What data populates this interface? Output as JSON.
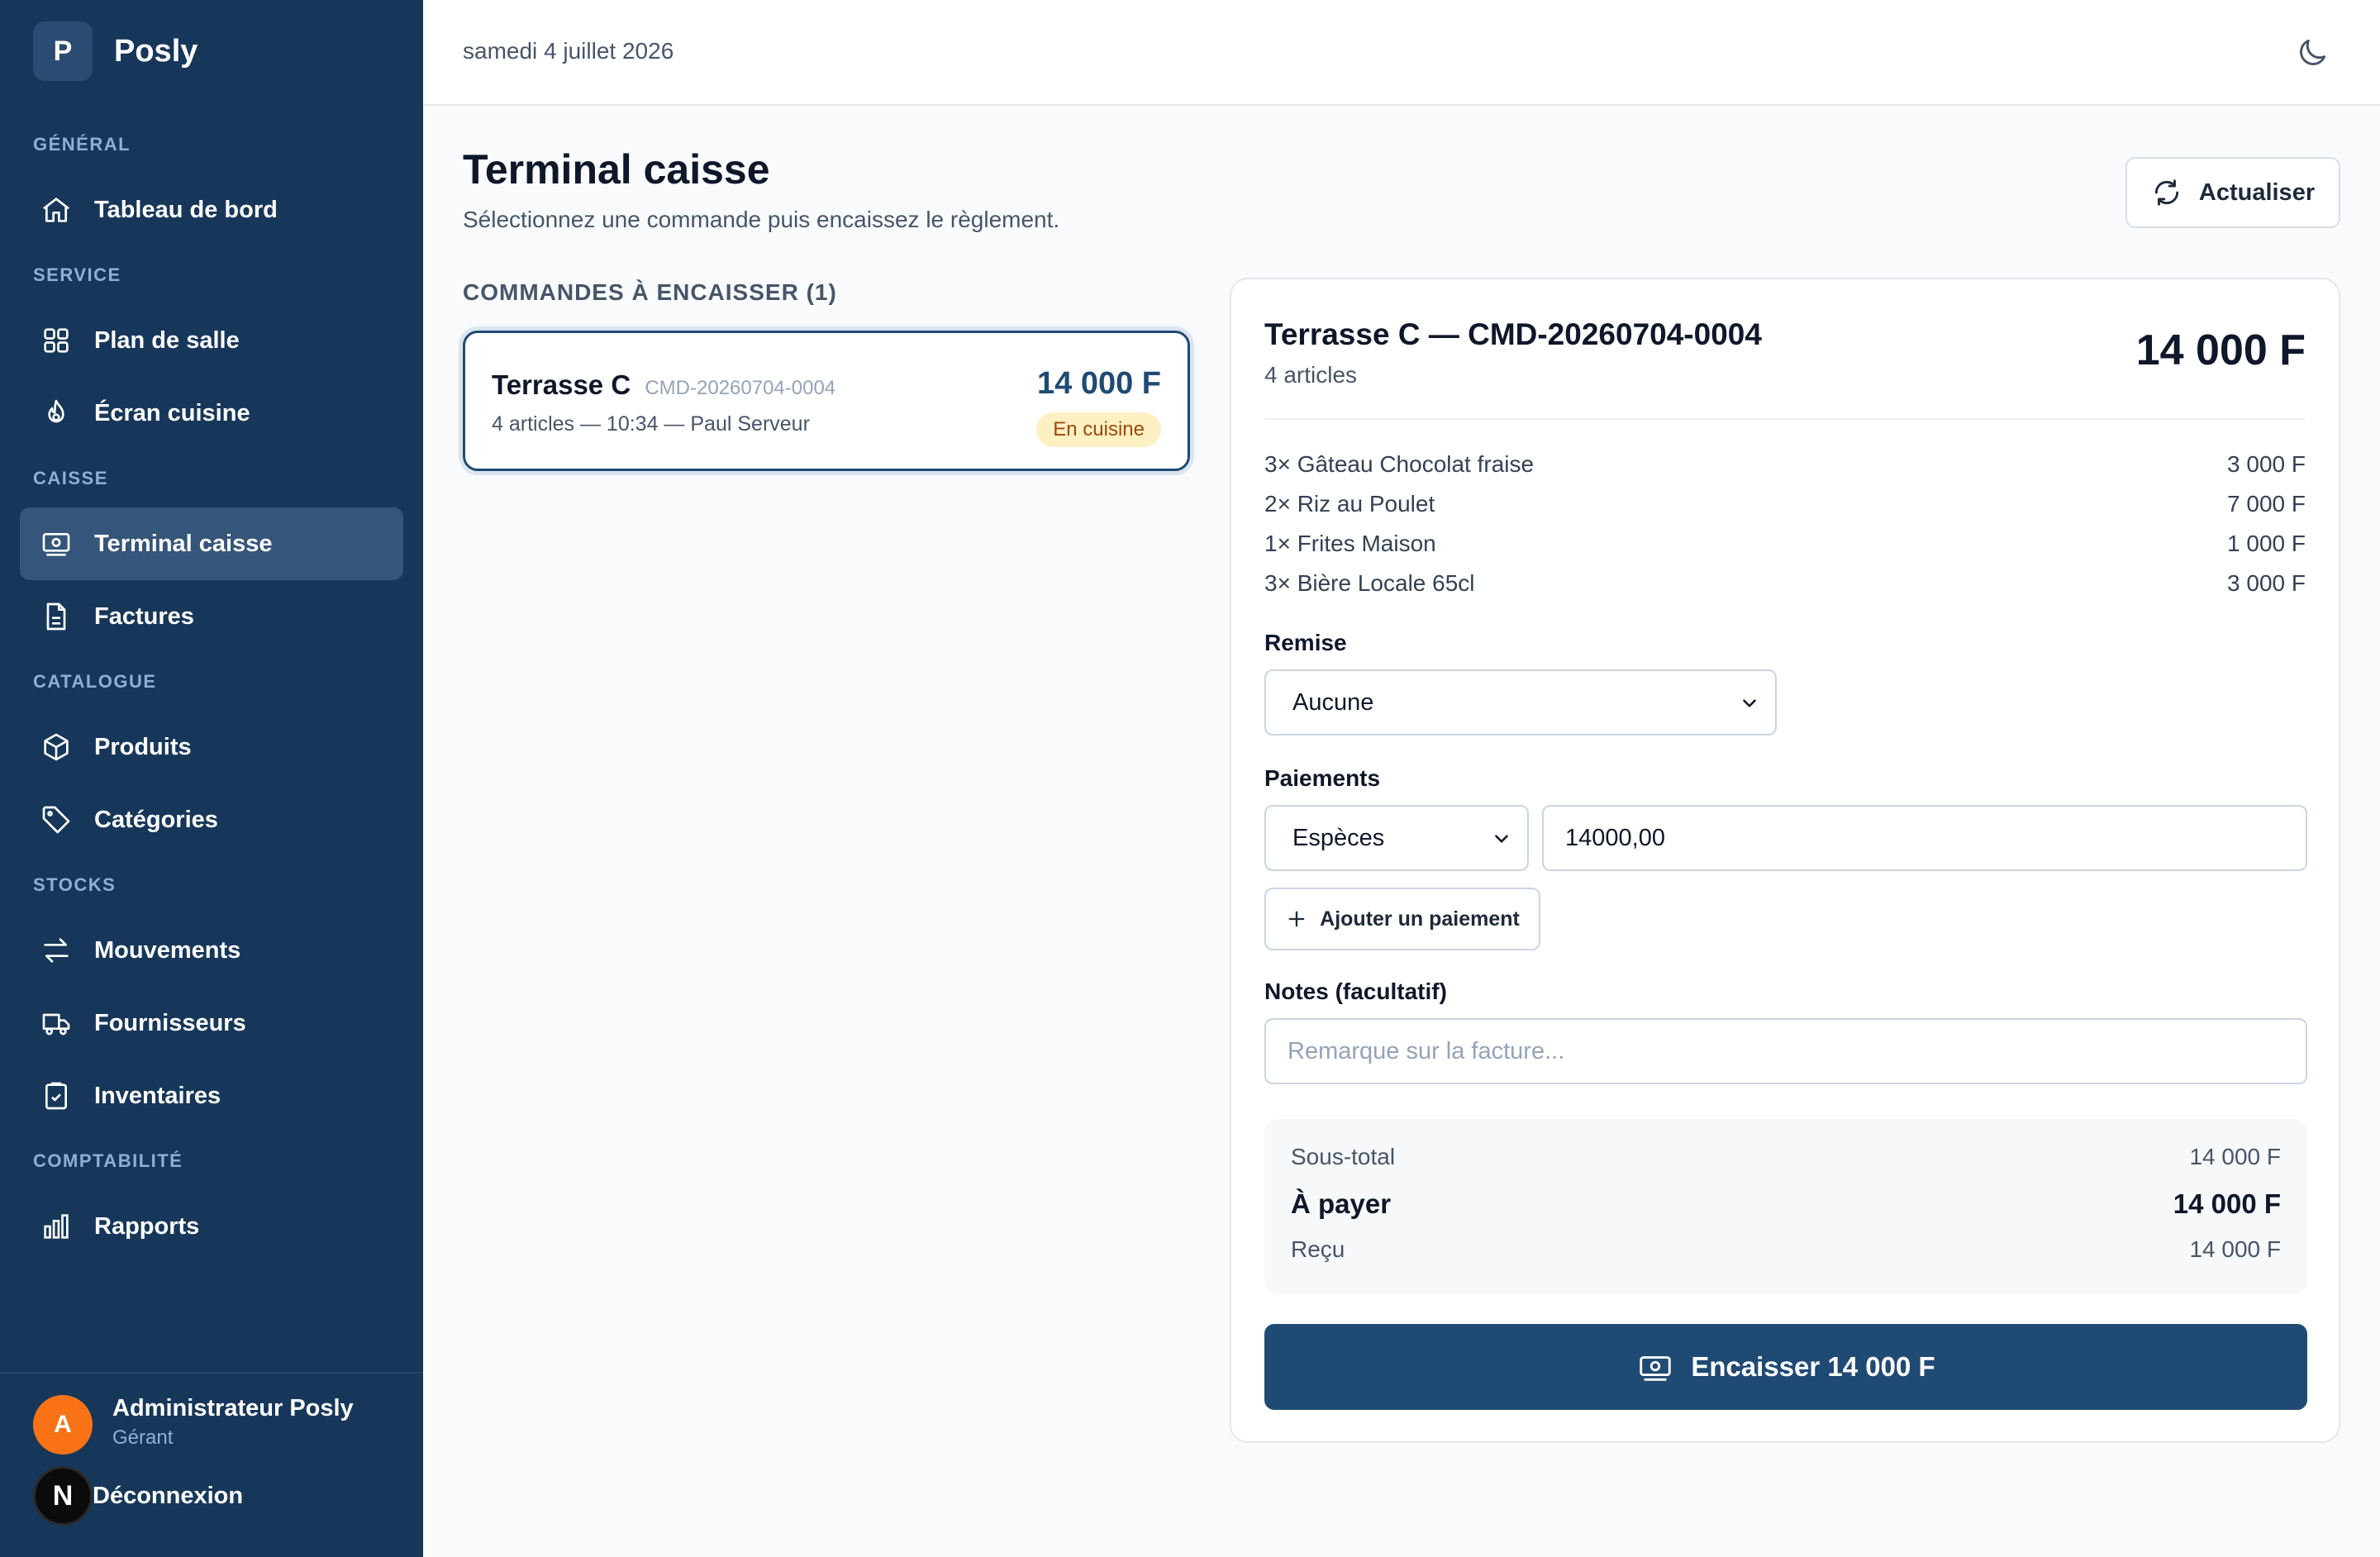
{
  "app": {
    "logo_letter": "P",
    "name": "Posly"
  },
  "sidebar": {
    "sections": [
      {
        "title": "GÉNÉRAL",
        "items": [
          {
            "label": "Tableau de bord",
            "icon": "home-icon"
          }
        ]
      },
      {
        "title": "SERVICE",
        "items": [
          {
            "label": "Plan de salle",
            "icon": "grid-icon"
          },
          {
            "label": "Écran cuisine",
            "icon": "flame-icon"
          }
        ]
      },
      {
        "title": "CAISSE",
        "items": [
          {
            "label": "Terminal caisse",
            "icon": "cash-register-icon",
            "active": true
          },
          {
            "label": "Factures",
            "icon": "file-text-icon"
          }
        ]
      },
      {
        "title": "CATALOGUE",
        "items": [
          {
            "label": "Produits",
            "icon": "box-icon"
          },
          {
            "label": "Catégories",
            "icon": "tag-icon"
          }
        ]
      },
      {
        "title": "STOCKS",
        "items": [
          {
            "label": "Mouvements",
            "icon": "arrows-swap-icon"
          },
          {
            "label": "Fournisseurs",
            "icon": "truck-icon"
          },
          {
            "label": "Inventaires",
            "icon": "clipboard-check-icon"
          }
        ]
      },
      {
        "title": "COMPTABILITÉ",
        "items": [
          {
            "label": "Rapports",
            "icon": "bar-chart-icon"
          }
        ]
      }
    ],
    "user": {
      "initial": "A",
      "name": "Administrateur Posly",
      "role": "Gérant"
    },
    "logout_badge": "N",
    "logout_label": "Déconnexion"
  },
  "topbar": {
    "date": "samedi 4 juillet 2026",
    "theme_icon": "moon-icon"
  },
  "page": {
    "title": "Terminal caisse",
    "subtitle": "Sélectionnez une commande puis encaissez le règlement.",
    "refresh_label": "Actualiser"
  },
  "orders": {
    "title": "COMMANDES À ENCAISSER (1)",
    "list": [
      {
        "table": "Terrasse C",
        "code": "CMD-20260704-0004",
        "meta": "4 articles — 10:34 — Paul Serveur",
        "total": "14 000 F",
        "status": "En cuisine"
      }
    ]
  },
  "detail": {
    "title": "Terrasse C — CMD-20260704-0004",
    "subtitle": "4 articles",
    "total": "14 000 F",
    "items": [
      {
        "label": "3× Gâteau Chocolat fraise",
        "price": "3 000 F"
      },
      {
        "label": "2× Riz au Poulet",
        "price": "7 000 F"
      },
      {
        "label": "1× Frites Maison",
        "price": "1 000 F"
      },
      {
        "label": "3× Bière Locale 65cl",
        "price": "3 000 F"
      }
    ],
    "discount_label": "Remise",
    "discount_value": "Aucune",
    "payments_label": "Paiements",
    "payment_method": "Espèces",
    "payment_amount": "14000,00",
    "add_payment_label": "Ajouter un paiement",
    "notes_label": "Notes (facultatif)",
    "notes_placeholder": "Remarque sur la facture...",
    "summary": {
      "subtotal_label": "Sous-total",
      "subtotal_value": "14 000 F",
      "due_label": "À payer",
      "due_value": "14 000 F",
      "received_label": "Reçu",
      "received_value": "14 000 F"
    },
    "pay_button_label": "Encaisser 14 000 F"
  },
  "colors": {
    "sidebar": "#17375a",
    "accent": "#1f4a74",
    "badge_bg": "#fdf0c2",
    "badge_text": "#9a4a0b",
    "avatar": "#f97316"
  }
}
